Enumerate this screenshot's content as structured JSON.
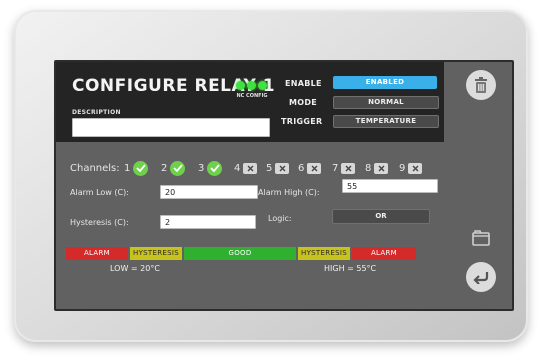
{
  "header": {
    "title": "CONFIGURE RELAY 1",
    "description_label": "DESCRIPTION",
    "description_value": "",
    "leds_label": "NC CONFIG",
    "led_color": "#3fe23f"
  },
  "properties": {
    "enable_label": "ENABLE",
    "enable_value": "ENABLED",
    "mode_label": "MODE",
    "mode_value": "NORMAL",
    "trigger_label": "TRIGGER",
    "trigger_value": "TEMPERATURE",
    "accent_color": "#39b0e8"
  },
  "channels": {
    "label": "Channels:",
    "items": [
      {
        "number": "1",
        "enabled": true
      },
      {
        "number": "2",
        "enabled": true
      },
      {
        "number": "3",
        "enabled": true
      },
      {
        "number": "4",
        "enabled": false
      },
      {
        "number": "5",
        "enabled": false
      },
      {
        "number": "6",
        "enabled": false
      },
      {
        "number": "7",
        "enabled": false
      },
      {
        "number": "8",
        "enabled": false
      },
      {
        "number": "9",
        "enabled": false
      }
    ]
  },
  "settings": {
    "alarm_low_label": "Alarm Low (C):",
    "alarm_low_value": "20",
    "alarm_high_label": "Alarm High (C):",
    "alarm_high_value": "55",
    "hysteresis_label": "Hysteresis (C):",
    "hysteresis_value": "2",
    "logic_label": "Logic:",
    "logic_value": "OR"
  },
  "range_bar": {
    "alarm_left": "ALARM",
    "hysteresis_left": "HYSTERESIS",
    "good": "GOOD",
    "hysteresis_right": "HYSTERESIS",
    "alarm_right": "ALARM",
    "low_threshold": "LOW = 20°C",
    "high_threshold": "HIGH = 55°C",
    "colors": {
      "alarm": "#d42a2a",
      "hysteresis": "#c8c21c",
      "good": "#2fb12f"
    }
  },
  "icons": {
    "trash": "trash-icon",
    "folder": "folder-icon",
    "back": "back-arrow-icon",
    "check": "check-icon",
    "cross": "x-icon"
  }
}
